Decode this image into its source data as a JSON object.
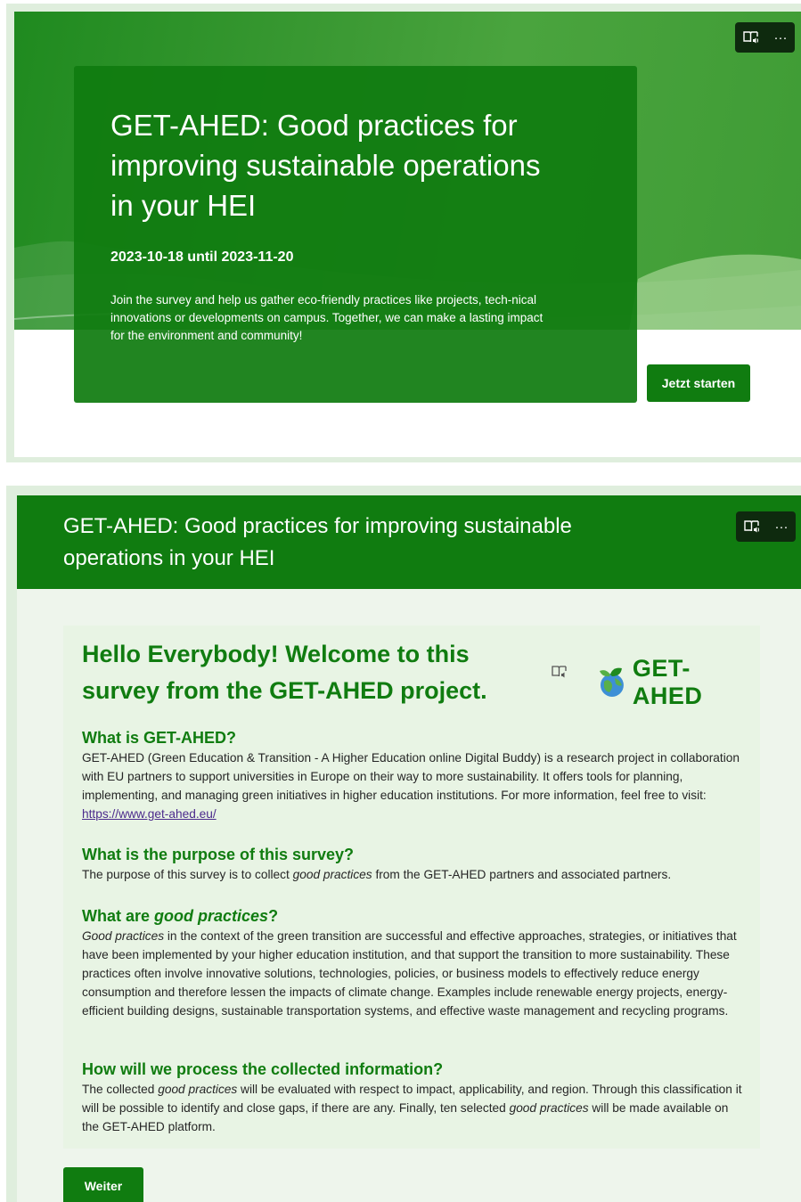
{
  "welcome": {
    "title": "GET-AHED: Good practices for improving sustainable operations in your HEI",
    "dates": "2023-10-18 until 2023-11-20",
    "description": "Join the survey and help us gather eco-friendly practices like projects, tech-nical innovations or developments on campus. Together, we can make a lasting impact for the environment and community!",
    "start_button": "Jetzt starten"
  },
  "toolbar": {
    "reader_icon": "immersive-reader-icon",
    "more_icon": "more-options-icon",
    "more_glyph": "···"
  },
  "form": {
    "header_title": "GET-AHED: Good practices for improving sustainable operations in your HEI",
    "welcome_heading": "Hello Everybody! Welcome to this survey from the GET-AHED project.",
    "logo_text": "GET-AHED",
    "sections": [
      {
        "heading": "What is GET-AHED?",
        "body": "GET-AHED (Green Education & Transition - A Higher Education online Digital Buddy) is a research project in collaboration with EU partners to support universities in Europe on their way to more sustainability. It offers tools for planning, implementing, and managing green initiatives in higher education institutions. For more information, feel free to visit: ",
        "link": "https://www.get-ahed.eu/"
      },
      {
        "heading": "What is the purpose of this survey?",
        "body_before": "The purpose of this survey is to collect ",
        "body_em": "good practices",
        "body_after": " from the GET-AHED partners and associated partners."
      },
      {
        "heading_before": "What are ",
        "heading_em": "good practices",
        "heading_after": "?",
        "body_em": "Good practices",
        "body": " in the context of the green transition are successful and effective approaches, strategies, or initiatives that have been implemented by your higher education institution, and that support the transition to more sustainability. These practices often involve innovative solutions, technologies, policies, or business models to effectively reduce energy consumption and therefore lessen the impacts of climate change. Examples include renewable energy projects, energy-efficient building designs, sustainable transportation systems, and effective waste management and recycling programs."
      },
      {
        "heading": "How will we process the collected information?",
        "body_1": "The collected ",
        "body_em_1": "good practices",
        "body_2": " will be evaluated with respect to impact, applicability, and region. Through this classification it will be possible to identify and close gaps, if there are any. Finally, ten selected ",
        "body_em_2": "good practices",
        "body_3": " will be made available on the GET-AHED platform."
      }
    ],
    "next_button": "Weiter"
  },
  "colors": {
    "brand_green": "#107c10",
    "dark_toolbar": "#0e2a0e",
    "link": "#4b2a8c"
  }
}
